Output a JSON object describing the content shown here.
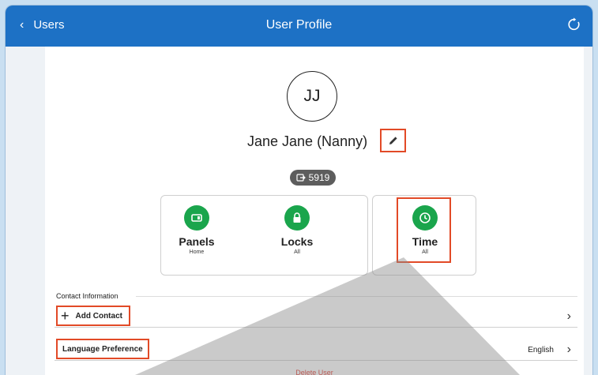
{
  "header": {
    "back_label": "Users",
    "title": "User Profile",
    "back_icon": "chevron-left-icon",
    "refresh_icon": "refresh-icon"
  },
  "profile": {
    "initials": "JJ",
    "name": "Jane Jane (Nanny)",
    "code": "5919",
    "code_icon": "keypad-code-icon",
    "edit_icon": "pencil-icon"
  },
  "features": [
    {
      "name": "Panels",
      "sub": "Home",
      "icon": "panel-icon"
    },
    {
      "name": "Locks",
      "sub": "All",
      "icon": "lock-icon"
    },
    {
      "name": "Time",
      "sub": "All",
      "icon": "clock-icon"
    }
  ],
  "contact": {
    "section_label": "Contact Information",
    "add_label": "Add Contact",
    "language_label": "Language Preference",
    "language_value": "English"
  },
  "actions": {
    "delete_label": "Delete User"
  },
  "colors": {
    "header_bg": "#1d71c5",
    "accent_green": "#1aa54c",
    "highlight": "#e24a27",
    "delete_red": "#e2362c"
  }
}
